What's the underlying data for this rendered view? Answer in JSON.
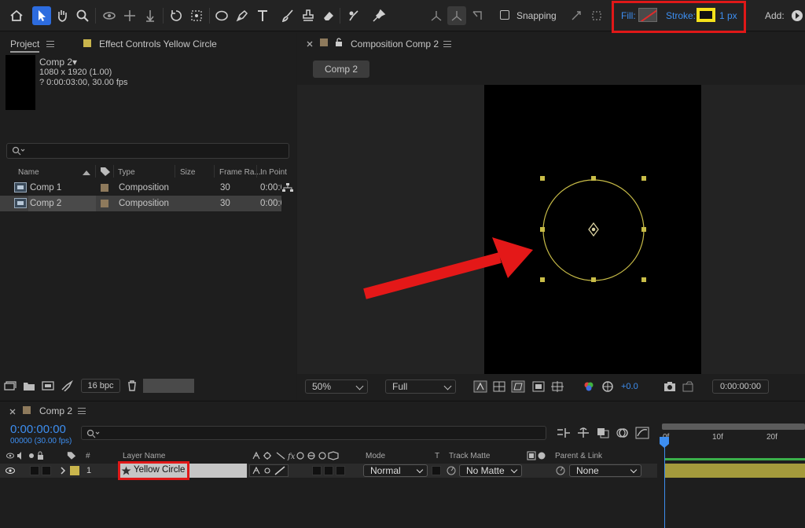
{
  "toolbar": {
    "tools": [
      "home-icon",
      "selection-icon",
      "hand-icon",
      "zoom-icon",
      "orbit-icon",
      "pan-behind-icon",
      "track-z-icon",
      "rotation-icon",
      "anchor-icon",
      "ellipse-icon",
      "pen-icon",
      "type-icon",
      "brush-icon",
      "clone-stamp-icon",
      "eraser-icon",
      "roto-brush-icon",
      "puppet-pin-icon"
    ],
    "snapping_label": "Snapping",
    "fill_label": "Fill:",
    "stroke_label": "Stroke:",
    "stroke_width": "1 px",
    "add_label": "Add:",
    "fill_color": "#e02a2a",
    "stroke_color": "#f5e21b"
  },
  "project": {
    "tab_project": "Project",
    "tab_effects": "Effect Controls Yellow Circle",
    "comp_name": "Comp 2▾",
    "comp_res": "1080 x 1920 (1.00)",
    "comp_duration": "? 0:00:03:00, 30.00 fps",
    "columns": {
      "name": "Name",
      "type": "Type",
      "size": "Size",
      "frame_rate": "Frame Ra...",
      "in_point": "In Point"
    },
    "rows": [
      {
        "name": "Comp 1",
        "type": "Composition",
        "frame_rate": "30",
        "in_point": "0:00:0"
      },
      {
        "name": "Comp 2",
        "type": "Composition",
        "frame_rate": "30",
        "in_point": "0:00:0"
      }
    ],
    "bpc": "16 bpc"
  },
  "viewer": {
    "tab_title": "Composition Comp 2",
    "chip": "Comp 2",
    "zoom": "50%",
    "resolution": "Full",
    "exposure": "+0.0",
    "timecode": "0:00:00:00"
  },
  "timeline": {
    "tab": "Comp 2",
    "timecode": "0:00:00:00",
    "frames": "00000 (30.00 fps)",
    "headers": {
      "num": "#",
      "layer_name": "Layer Name",
      "mode": "Mode",
      "t": "T",
      "track_matte": "Track Matte",
      "parent": "Parent & Link"
    },
    "layer": {
      "num": "1",
      "name": "Yellow Circle",
      "mode": "Normal",
      "matte": "No Matte",
      "parent": "None"
    },
    "ruler": [
      "0f",
      "10f",
      "20f"
    ]
  }
}
